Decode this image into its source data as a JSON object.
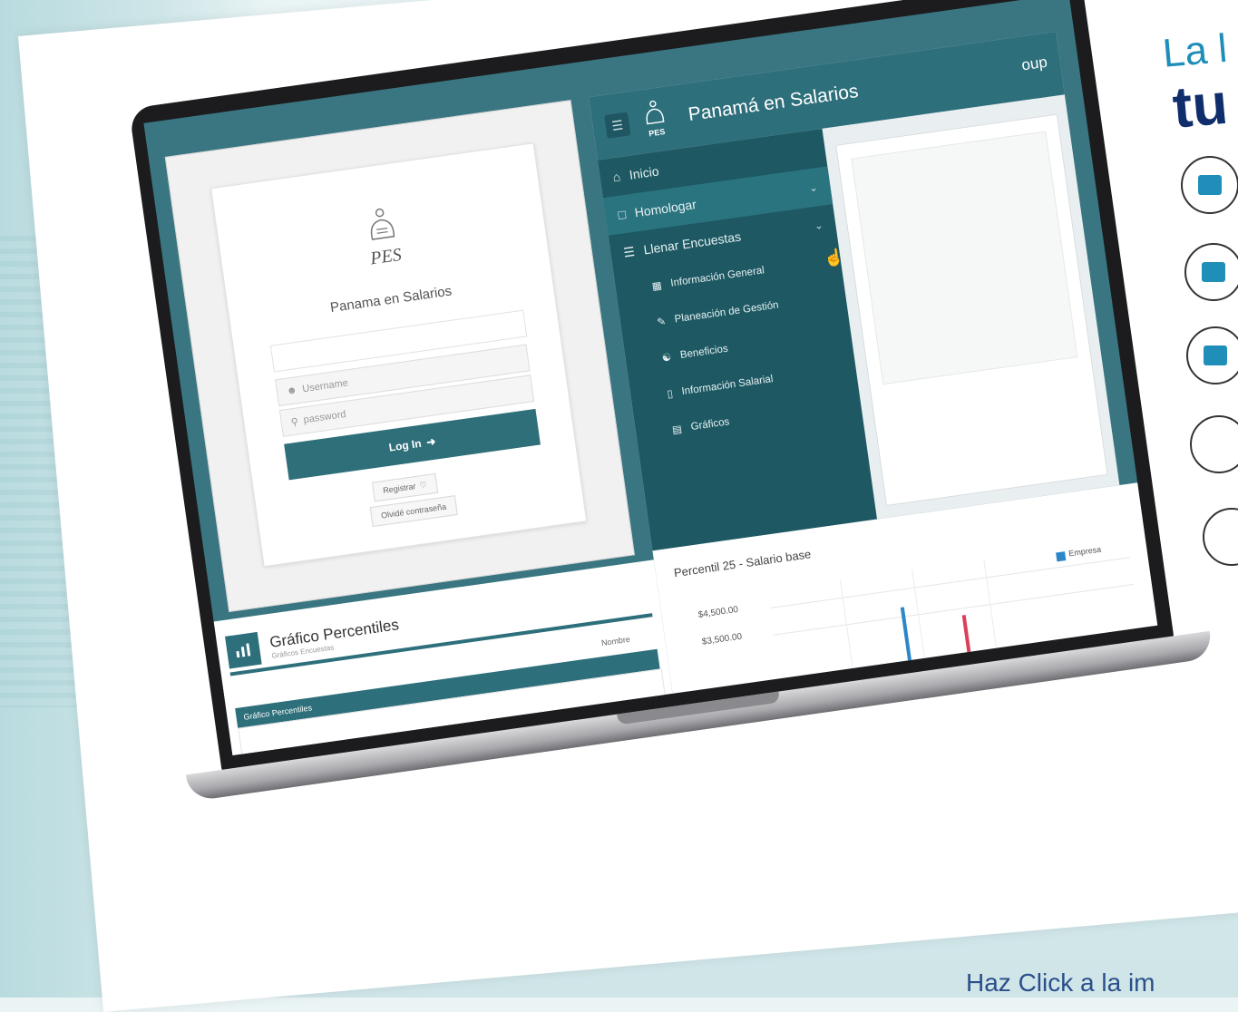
{
  "login": {
    "logo_text": "PES",
    "title": "Panama en Salarios",
    "username_placeholder": "Username",
    "password_placeholder": "password",
    "login_button": "Log In",
    "register_button": "Registrar",
    "forgot_button": "Olvidé contraseña"
  },
  "app": {
    "logo_text": "PES",
    "title": "Panamá en Salarios",
    "user": "oup",
    "menu": [
      {
        "label": "Inicio",
        "icon": "home-icon"
      },
      {
        "label": "Homologar",
        "icon": "file-icon"
      },
      {
        "label": "Llenar Encuestas",
        "icon": "list-icon"
      }
    ],
    "submenu": [
      {
        "label": "Información General",
        "icon": "info-card-icon"
      },
      {
        "label": "Planeación de Gestión",
        "icon": "edit-icon"
      },
      {
        "label": "Beneficios",
        "icon": "handshake-icon"
      },
      {
        "label": "Información Salarial",
        "icon": "phone-icon"
      },
      {
        "label": "Gráficos",
        "icon": "bar-chart-icon"
      }
    ]
  },
  "graficos": {
    "title": "Gráfico Percentiles",
    "subtitle": "Gráficos Encuestas",
    "panel_title": "Gráfico Percentiles",
    "right_label": "Nombre"
  },
  "chart_data": {
    "type": "bar",
    "title": "Percentil 25 - Salario base",
    "y_ticks": [
      "$4,500.00",
      "$3,500.00"
    ],
    "legend": "Empresa"
  },
  "promo": {
    "line1": "La l",
    "line2": "tu",
    "cta": "Haz Click a la im"
  },
  "colors": {
    "teal": "#2d6f7b",
    "dark_teal": "#1e5963",
    "promo_blue": "#1f8eb8",
    "promo_navy": "#0f2e6b"
  }
}
